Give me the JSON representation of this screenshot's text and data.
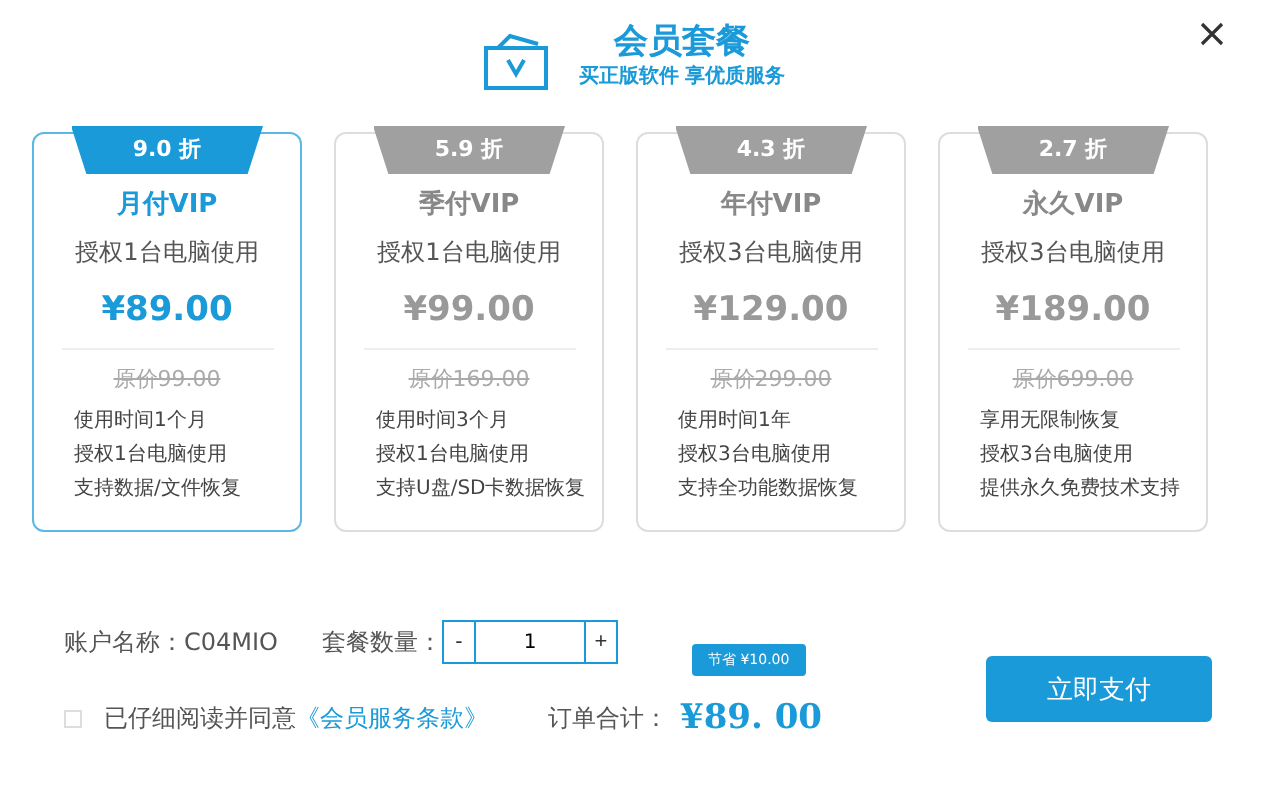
{
  "header": {
    "title": "会员套餐",
    "subtitle": "买正版软件 享优质服务"
  },
  "plans": [
    {
      "selected": true,
      "discount": "9.0 折",
      "name": "月付VIP",
      "devices": "授权1台电脑使用",
      "price": "¥89.00",
      "original_price": "原价99.00",
      "features": [
        "使用时间1个月",
        "授权1台电脑使用",
        "支持数据/文件恢复"
      ]
    },
    {
      "selected": false,
      "discount": "5.9 折",
      "name": "季付VIP",
      "devices": "授权1台电脑使用",
      "price": "¥99.00",
      "original_price": "原价169.00",
      "features": [
        "使用时间3个月",
        "授权1台电脑使用",
        "支持U盘/SD卡数据恢复"
      ]
    },
    {
      "selected": false,
      "discount": "4.3 折",
      "name": "年付VIP",
      "devices": "授权3台电脑使用",
      "price": "¥129.00",
      "original_price": "原价299.00",
      "features": [
        "使用时间1年",
        "授权3台电脑使用",
        "支持全功能数据恢复"
      ]
    },
    {
      "selected": false,
      "discount": "2.7 折",
      "name": "永久VIP",
      "devices": "授权3台电脑使用",
      "price": "¥189.00",
      "original_price": "原价699.00",
      "features": [
        "享用无限制恢复",
        "授权3台电脑使用",
        "提供永久免费技术支持"
      ]
    }
  ],
  "account": {
    "label": "账户名称：",
    "value": "C04MIO"
  },
  "quantity": {
    "label": "套餐数量：",
    "minus": "-",
    "value": "1",
    "plus": "+"
  },
  "agreement": {
    "checked": false,
    "text": "已仔细阅读并同意",
    "link": "《会员服务条款》"
  },
  "total": {
    "label": "订单合计：",
    "amount": "¥89. 00",
    "savings": "节省 ¥10.00"
  },
  "pay_button": "立即支付"
}
